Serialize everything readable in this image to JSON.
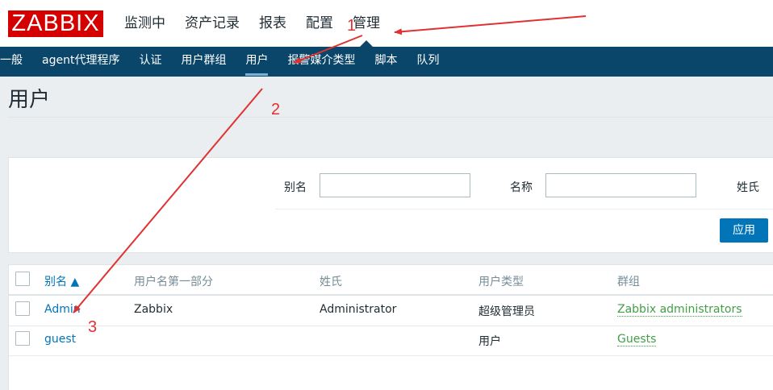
{
  "logo": "ZABBIX",
  "topnav": [
    "监测中",
    "资产记录",
    "报表",
    "配置",
    "管理"
  ],
  "subnav": [
    "一般",
    "agent代理程序",
    "认证",
    "用户群组",
    "用户",
    "报警媒介类型",
    "脚本",
    "队列"
  ],
  "page_title": "用户",
  "filter": {
    "alias_label": "别名",
    "name_label": "名称",
    "surname_label": "姓氏",
    "alias_value": "",
    "name_value": "",
    "apply_label": "应用"
  },
  "table": {
    "headers": {
      "alias": "别名 ▲",
      "name": "用户名第一部分",
      "surname": "姓氏",
      "type": "用户类型",
      "groups": "群组"
    },
    "rows": [
      {
        "alias": "Admin",
        "name": "Zabbix",
        "surname": "Administrator",
        "type": "超级管理员",
        "groups": "Zabbix administrators"
      },
      {
        "alias": "guest",
        "name": "",
        "surname": "",
        "type": "用户",
        "groups": "Guests"
      }
    ]
  },
  "annotations": [
    "1",
    "2",
    "3"
  ],
  "colors": {
    "brand_red": "#d40000",
    "nav_dark": "#0a466a",
    "link_blue": "#0275b8",
    "group_green": "#429e47",
    "annotation_red": "#e03232"
  }
}
